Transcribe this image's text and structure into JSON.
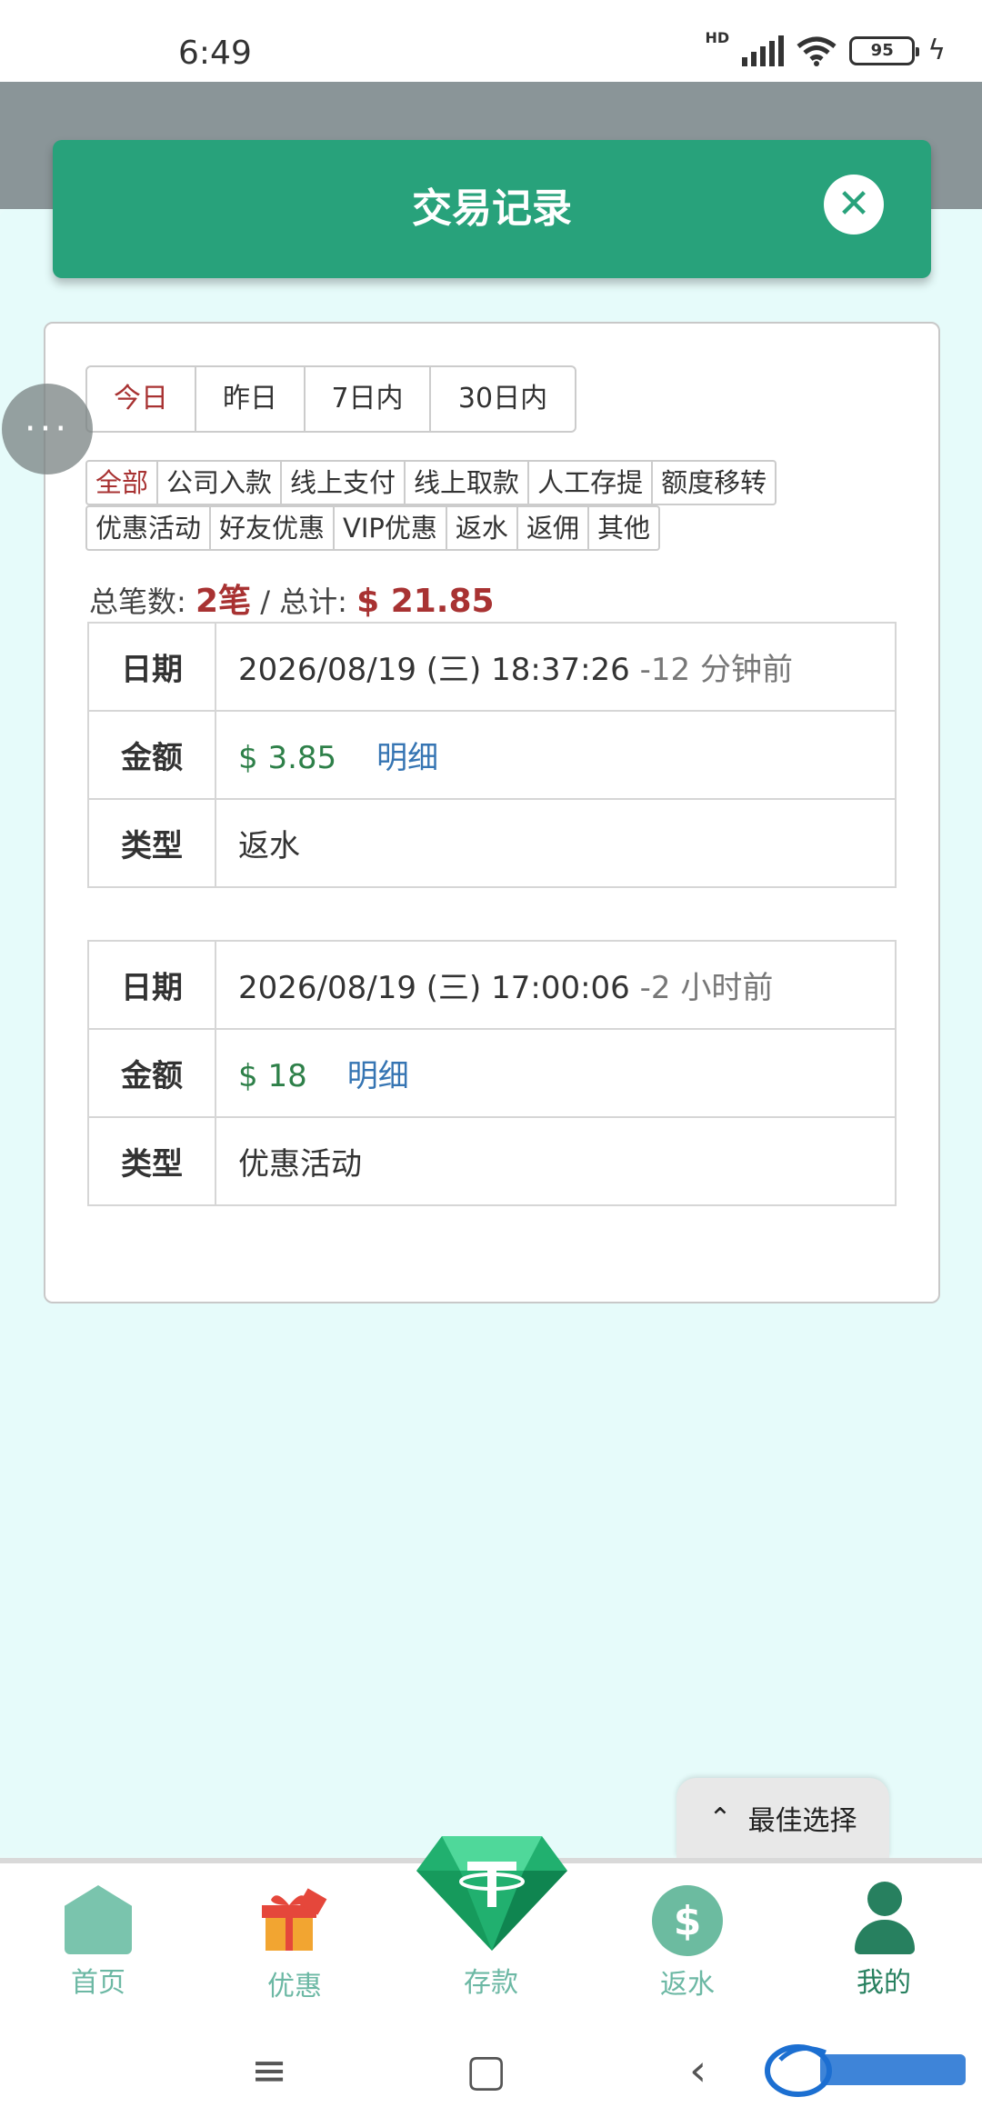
{
  "status_bar": {
    "time": "6:49",
    "network": "HD",
    "battery": "95"
  },
  "modal": {
    "title": "交易记录"
  },
  "date_filters": [
    {
      "label": "今日",
      "active": true
    },
    {
      "label": "昨日",
      "active": false
    },
    {
      "label": "7日内",
      "active": false
    },
    {
      "label": "30日内",
      "active": false
    }
  ],
  "categories_row1": [
    {
      "label": "全部",
      "active": true
    },
    {
      "label": "公司入款",
      "active": false
    },
    {
      "label": "线上支付",
      "active": false
    },
    {
      "label": "线上取款",
      "active": false
    },
    {
      "label": "人工存提",
      "active": false
    },
    {
      "label": "额度移转",
      "active": false
    }
  ],
  "categories_row2": [
    {
      "label": "优惠活动",
      "active": false
    },
    {
      "label": "好友优惠",
      "active": false
    },
    {
      "label": "VIP优惠",
      "active": false
    },
    {
      "label": "返水",
      "active": false
    },
    {
      "label": "返佣",
      "active": false
    },
    {
      "label": "其他",
      "active": false
    }
  ],
  "summary": {
    "count_label": "总笔数:",
    "count_value": "2笔",
    "separator": "/",
    "total_label": "总计:",
    "total_value": "$ 21.85"
  },
  "records": [
    {
      "date_key": "日期",
      "date": "2026/08/19 (三) 18:37:26",
      "ago": "-12 分钟前",
      "amount_key": "金额",
      "amount": "$ 3.85",
      "detail": "明细",
      "type_key": "类型",
      "type": "返水"
    },
    {
      "date_key": "日期",
      "date": "2026/08/19 (三) 17:00:06",
      "ago": "-2 小时前",
      "amount_key": "金额",
      "amount": "$ 18",
      "detail": "明细",
      "type_key": "类型",
      "type": "优惠活动"
    }
  ],
  "float_menu": {
    "icon": "more-dots-icon",
    "label": "···"
  },
  "best_choice": {
    "icon": "chevron-up-icon",
    "arrow": "⌃",
    "label": "最佳选择"
  },
  "bottom_nav": [
    {
      "label": "首页",
      "icon": "home-icon"
    },
    {
      "label": "优惠",
      "icon": "gift-icon"
    },
    {
      "label": "存款",
      "icon": "diamond-icon"
    },
    {
      "label": "返水",
      "icon": "dollar-badge-icon",
      "symbol": "$"
    },
    {
      "label": "我的",
      "icon": "user-icon",
      "active": true
    }
  ],
  "system_nav": {
    "menu": "≡",
    "home": "▢",
    "back": "‹"
  },
  "colors": {
    "primary": "#28a27b",
    "active_red": "#a83232",
    "amount_green": "#2e8049",
    "link_blue": "#3675b3"
  }
}
